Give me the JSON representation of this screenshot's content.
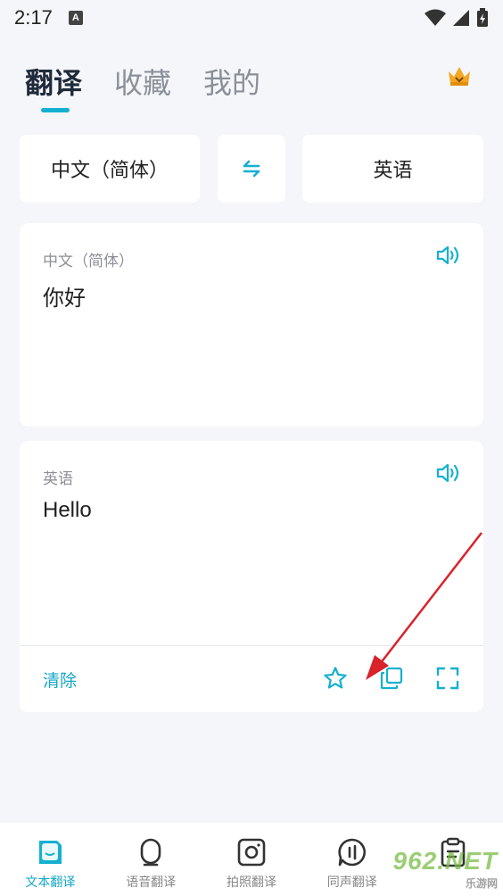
{
  "status_bar": {
    "time": "2:17",
    "notif_letter": "A"
  },
  "tabs": [
    {
      "label": "翻译",
      "active": true
    },
    {
      "label": "收藏",
      "active": false
    },
    {
      "label": "我的",
      "active": false
    }
  ],
  "languages": {
    "source": "中文（简体）",
    "target": "英语"
  },
  "source_card": {
    "language": "中文（简体）",
    "text": "你好"
  },
  "target_card": {
    "language": "英语",
    "text": "Hello",
    "clear_label": "清除"
  },
  "bottom_nav": [
    {
      "label": "文本翻译",
      "icon": "text-translate-icon",
      "active": true
    },
    {
      "label": "语音翻译",
      "icon": "microphone-icon",
      "active": false
    },
    {
      "label": "拍照翻译",
      "icon": "camera-icon",
      "active": false
    },
    {
      "label": "同声翻译",
      "icon": "simultaneous-icon",
      "active": false
    },
    {
      "label": "",
      "icon": "clipboard-icon",
      "active": false
    }
  ],
  "watermark": {
    "text": "962.NET",
    "sub": "乐游网"
  },
  "colors": {
    "accent": "#14b0d0",
    "background": "#f5f6f9",
    "arrow": "#d9232a"
  }
}
